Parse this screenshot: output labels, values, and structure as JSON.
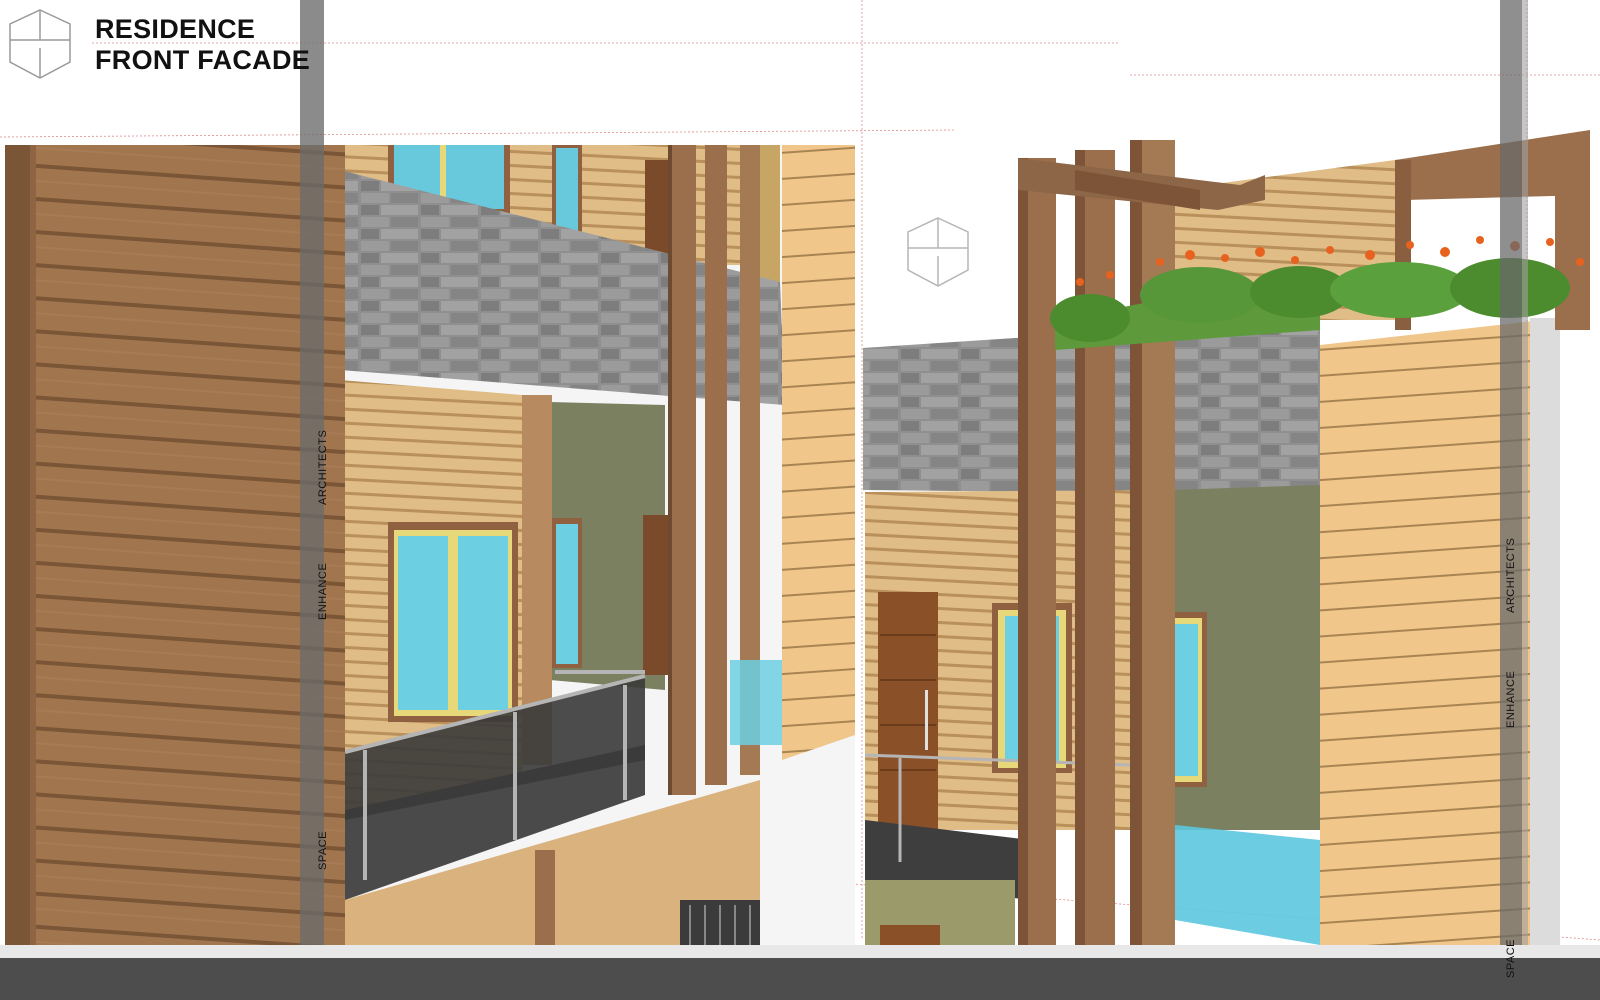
{
  "title": {
    "line1": "RESIDENCE",
    "line2": "FRONT FACADE"
  },
  "watermark_text": {
    "left_band": [
      "ARCHITECTS",
      "ENHANCE",
      "SPACE"
    ],
    "right_band": [
      "ARCHITECTS",
      "ENHANCE",
      "SPACE"
    ]
  },
  "colors": {
    "cladding_dark": "#9c7250",
    "cladding_light": "#d9b27a",
    "stone": "#8a8a8a",
    "glass": "#6fd0e0",
    "wall_olive": "#7b8060",
    "pergola": "#8d6647",
    "band": "#6e6e6e",
    "footer": "#4d4d4d"
  },
  "icons": [
    "logo-cube-icon",
    "logo-cube-watermark-icon"
  ]
}
